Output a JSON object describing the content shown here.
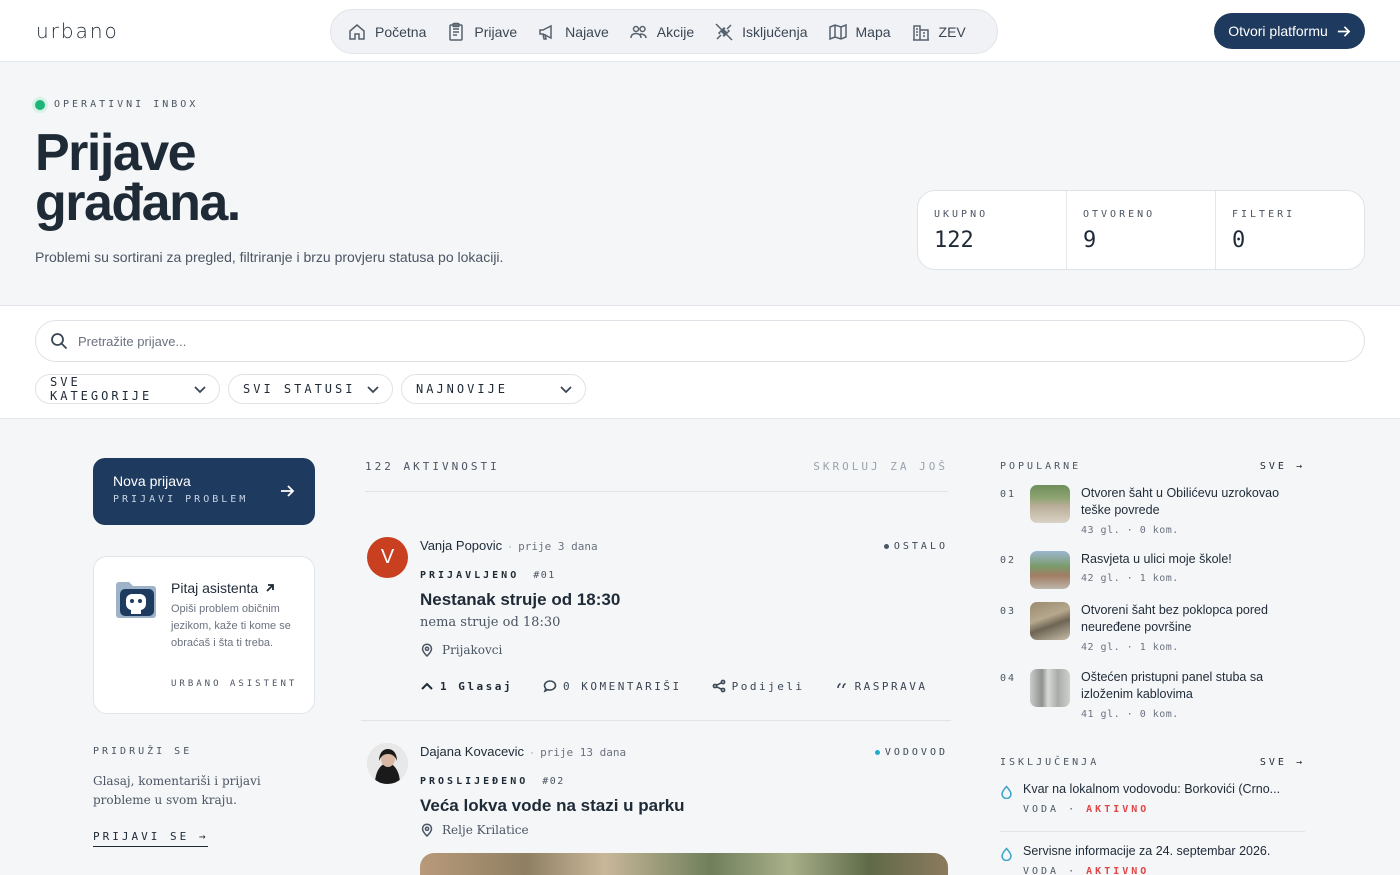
{
  "app": {
    "logo": "urbano",
    "cta_label": "Otvori platformu"
  },
  "nav": [
    {
      "label": "Početna",
      "icon": "home-icon"
    },
    {
      "label": "Prijave",
      "icon": "clipboard-icon"
    },
    {
      "label": "Najave",
      "icon": "megaphone-icon"
    },
    {
      "label": "Akcije",
      "icon": "people-icon"
    },
    {
      "label": "Isključenja",
      "icon": "unplug-icon"
    },
    {
      "label": "Mapa",
      "icon": "map-icon"
    },
    {
      "label": "ZEV",
      "icon": "building-icon"
    }
  ],
  "hero": {
    "eyebrow": "OPERATIVNI INBOX",
    "title_line1": "Prijave",
    "title_line2": "građana.",
    "subtitle": "Problemi su sortirani za pregled, filtriranje i brzu provjeru statusa po lokaciji.",
    "stats": [
      {
        "label": "UKUPNO",
        "value": "122"
      },
      {
        "label": "OTVORENO",
        "value": "9"
      },
      {
        "label": "FILTERI",
        "value": "0"
      }
    ]
  },
  "filters": {
    "search_placeholder": "Pretražite prijave...",
    "category": "SVE KATEGORIJE",
    "status": "SVI STATUSI",
    "sort": "NAJNOVIJE"
  },
  "sidebar": {
    "new_title": "Nova prijava",
    "new_sub": "PRIJAVI PROBLEM",
    "assistant_title": "Pitaj asistenta",
    "assistant_desc": "Opiši problem običnim jezikom, kaže ti kome se obraćaš i šta ti treba.",
    "assistant_foot": "URBANO ASISTENT",
    "join_label": "PRIDRUŽI SE",
    "join_text": "Glasaj, komentariši i prijavi probleme u svom kraju.",
    "join_link": "PRIJAVI SE →"
  },
  "feed": {
    "count_label": "122 AKTIVNOSTI",
    "scroll_hint": "SKROLUJ ZA JOŠ",
    "posts": [
      {
        "initial": "V",
        "author": "Vanja Popovic",
        "time": "prije 3 dana",
        "category": "OSTALO",
        "category_color": "#4b5563",
        "status": "PRIJAVLJENO",
        "number": "#01",
        "title": "Nestanak struje od 18:30",
        "desc": "nema struje od 18:30",
        "location": "Prijakovci",
        "votes": "1 Glasaj",
        "comments": "0 KOMENTARIŠI",
        "share": "Podijeli",
        "discussion": "RASPRAVA"
      },
      {
        "author": "Dajana Kovacevic",
        "time": "prije 13 dana",
        "category": "VODOVOD",
        "category_color": "#1bb0c8",
        "status": "PROSLIJEĐENO",
        "number": "#02",
        "title": "Veća lokva vode na stazi u parku",
        "location": "Relje Krilatice"
      }
    ]
  },
  "popular": {
    "label": "POPULARNE",
    "all": "SVE →",
    "items": [
      {
        "n": "01",
        "title": "Otvoren šaht u Obilićevu uzrokovao teške povrede",
        "votes": "43 gl.",
        "comments": "0 kom."
      },
      {
        "n": "02",
        "title": "Rasvjeta u ulici moje škole!",
        "votes": "42 gl.",
        "comments": "1 kom."
      },
      {
        "n": "03",
        "title": "Otvoreni šaht bez poklopca pored neuređene površine",
        "votes": "42 gl.",
        "comments": "1 kom."
      },
      {
        "n": "04",
        "title": "Oštećen pristupni panel stuba sa izloženim kablovima",
        "votes": "41 gl.",
        "comments": "0 kom."
      }
    ]
  },
  "outages": {
    "label": "ISKLJUČENJA",
    "all": "SVE →",
    "items": [
      {
        "title": "Kvar na lokalnom vodovodu: Borkovići (Crno...",
        "type": "VODA",
        "status": "AKTIVNO"
      },
      {
        "title": "Servisne informacije za 24. septembar 2026.",
        "type": "VODA",
        "status": "AKTIVNO"
      }
    ]
  }
}
